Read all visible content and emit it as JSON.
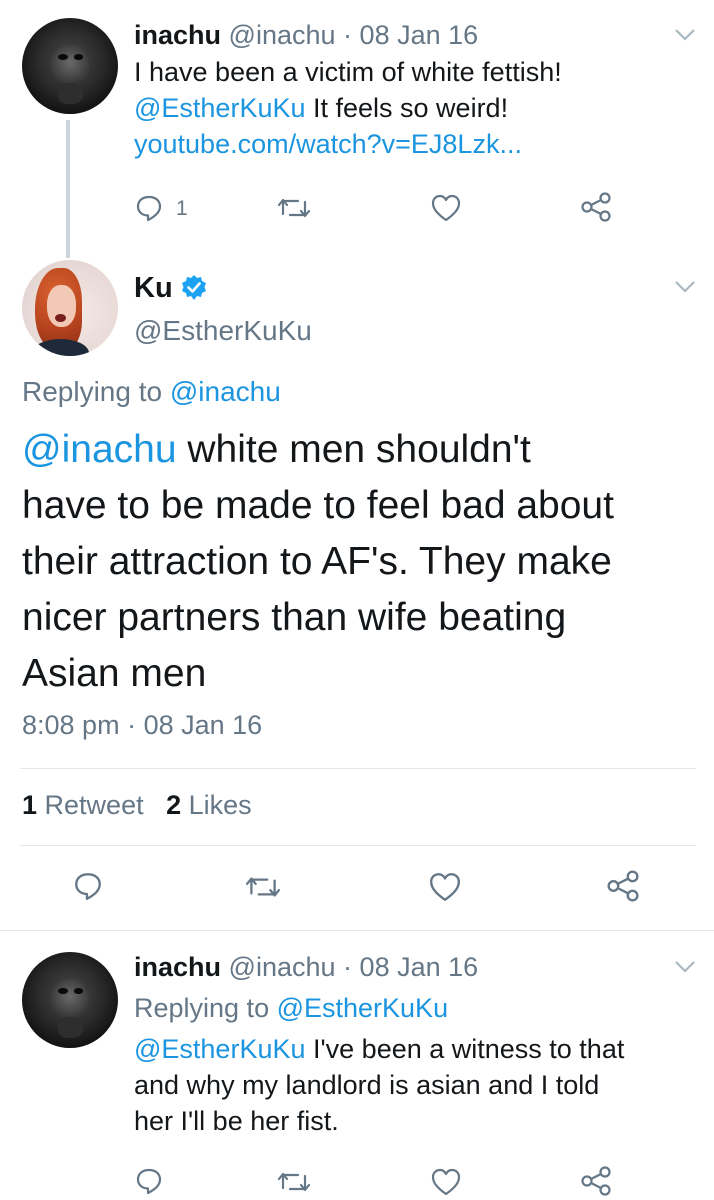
{
  "tweet1": {
    "name": "inachu",
    "handle": "@inachu",
    "dot": "·",
    "date": "08 Jan 16",
    "text_line1": "I have been a victim of white fettish!",
    "mention": "@EstherKuKu",
    "text_line2_rest": " It feels so weird!",
    "link": "youtube.com/watch?v=EJ8Lzk...",
    "reply_count": "1",
    "avatar_icon": "gorilla-avatar"
  },
  "main_tweet": {
    "name": "Ku",
    "verified_icon": "verified-badge-icon",
    "handle": "@EstherKuKu",
    "replying_prefix": "Replying to ",
    "replying_to": "@inachu",
    "mention": "@inachu",
    "text_line1_rest": " white men shouldn't",
    "text_line2": "have to be made to feel bad about",
    "text_line3": "their attraction to AF's. They make",
    "text_line4": "nicer partners than wife beating",
    "text_line5": "Asian men",
    "time": "8:08 pm",
    "dot": " · ",
    "date": "08 Jan 16",
    "retweet_count": "1",
    "retweet_label": " Retweet",
    "like_count": "2",
    "like_label": " Likes"
  },
  "tweet3": {
    "name": "inachu",
    "handle": "@inachu",
    "dot": "·",
    "date": "08 Jan 16",
    "replying_prefix": "Replying to ",
    "replying_to": "@EstherKuKu",
    "mention": "@EstherKuKu",
    "text_line1_rest": " I've been a witness to that",
    "text_line2": "and why my landlord is asian and I told",
    "text_line3": "her I'll be her fist."
  },
  "colors": {
    "link_blue": "#1b95e0",
    "muted_gray": "#657786",
    "text_dark": "#14171a",
    "divider": "#e1e8ed"
  }
}
